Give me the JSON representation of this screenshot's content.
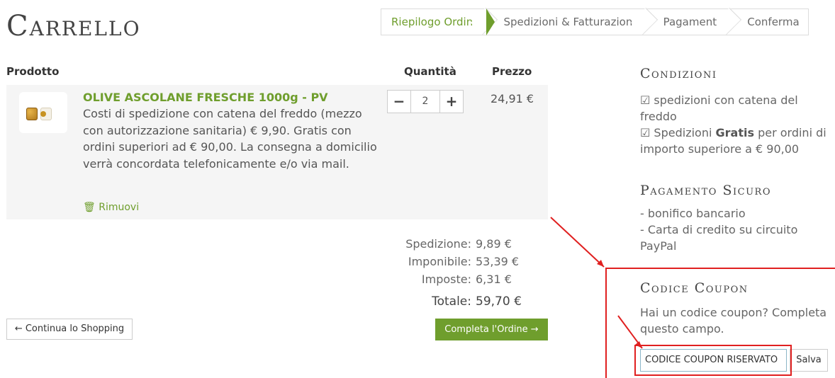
{
  "page_title": "Carrello",
  "steps": [
    "Riepilogo Ordine",
    "Spedizioni & Fatturazione",
    "Pagamento",
    "Conferma"
  ],
  "table": {
    "col_product": "Prodotto",
    "col_qty": "Quantità",
    "col_price": "Prezzo"
  },
  "item": {
    "name": "OLIVE ASCOLANE FRESCHE 1000g - PV",
    "description": "Costi di spedizione con catena del freddo (mezzo con autorizzazione sanitaria) € 9,90. Gratis con ordini superiori ad € 90,00.  La consegna a domicilio verrà concordata telefonicamente e/o via mail.",
    "remove_label": "Rimuovi",
    "quantity": "2",
    "price": "24,91 €"
  },
  "summary": {
    "shipping_label": "Spedizione:",
    "shipping_value": "9,89 €",
    "taxable_label": "Imponibile:",
    "taxable_value": "53,39 €",
    "taxes_label": "Imposte:",
    "taxes_value": "6,31 €",
    "total_label": "Totale:",
    "total_value": "59,70 €"
  },
  "buttons": {
    "continue": "← Continua lo Shopping",
    "complete": "Completa l'Ordine →"
  },
  "sidebar": {
    "conditions_title": "Condizioni",
    "conditions_line1": "☑ spedizioni con catena del freddo",
    "conditions_line2_prefix": "☑ Spedizioni ",
    "conditions_line2_bold": "Gratis",
    "conditions_line2_suffix": " per ordini di importo superiore a € 90,00",
    "payment_title": "Pagamento Sicuro",
    "payment_line1": "- bonifico bancario",
    "payment_line2": "- Carta di credito su circuito PayPal",
    "coupon_title": "Codice Coupon",
    "coupon_text": "Hai un codice coupon? Completa questo campo.",
    "coupon_value": "CODICE COUPON RISERVATO",
    "coupon_save": "Salva"
  },
  "colors": {
    "accent_green": "#6f9e2d",
    "annotation_red": "#e02020"
  }
}
